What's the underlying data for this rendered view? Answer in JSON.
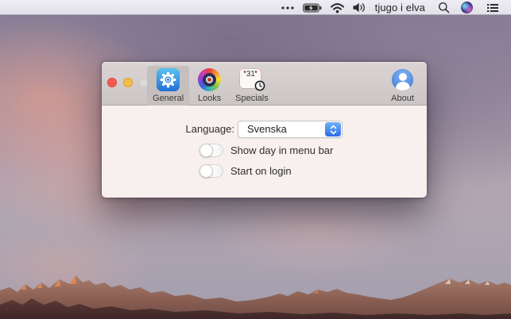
{
  "menu_bar": {
    "clock_text": "tjugo i elva",
    "icons": [
      "ellipsis-icon",
      "battery-charging-icon",
      "wifi-icon",
      "volume-icon",
      "search-icon",
      "siri-icon",
      "notification-center-icon"
    ]
  },
  "window": {
    "toolbar": {
      "tabs": [
        {
          "label": "General",
          "selected": true,
          "icon": "gear-app-icon"
        },
        {
          "label": "Looks",
          "selected": false,
          "icon": "color-wheel-icon"
        },
        {
          "label": "Specials",
          "selected": false,
          "icon": "calendar-clock-icon"
        },
        {
          "label": "About",
          "selected": false,
          "icon": "user-icon"
        }
      ],
      "calendar_day": "31",
      "traffic_lights": [
        "close",
        "minimize",
        "zoom-disabled"
      ]
    },
    "content": {
      "language": {
        "label": "Language:",
        "value": "Svenska"
      },
      "toggles": [
        {
          "label": "Show day in menu bar",
          "state": "off"
        },
        {
          "label": "Start on login",
          "state": "off"
        }
      ]
    }
  },
  "colors": {
    "accent_blue": "#2e6ee6",
    "traffic_red": "#f25b51",
    "traffic_yellow": "#f5bd4a",
    "traffic_disabled": "#dedad9",
    "toolbar_bg": "#d2cbcb",
    "content_bg": "#f7f0ee",
    "menubar_bg": "#e8e7ee"
  }
}
